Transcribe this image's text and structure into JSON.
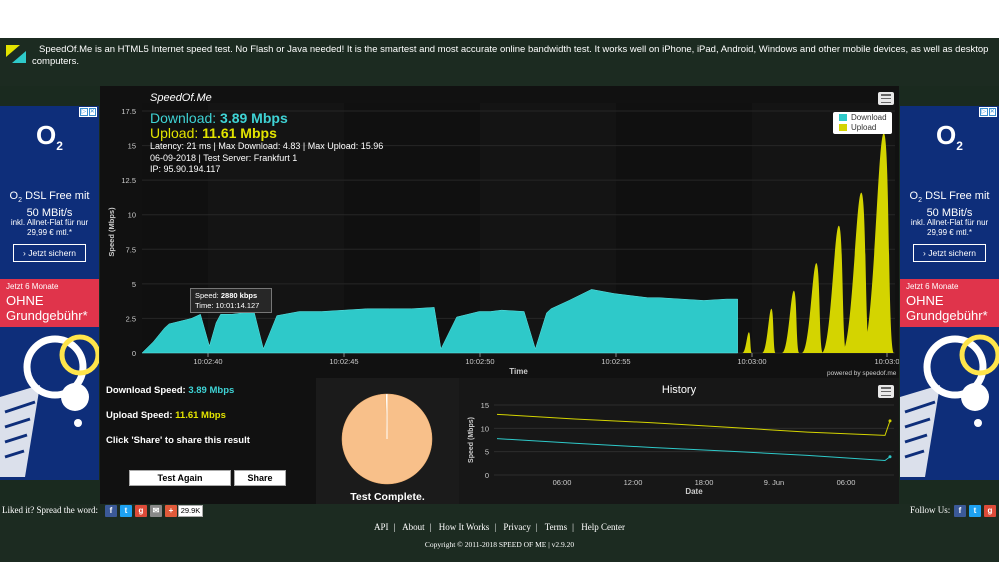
{
  "intro": {
    "text": "SpeedOf.Me is an HTML5 Internet speed test. No Flash or Java needed! It is the smartest and most accurate online bandwidth test. It works well on iPhone, iPad, Android, Windows and other mobile devices, as well as desktop computers."
  },
  "ad": {
    "brand": "O",
    "brand_sub": "2",
    "headline_a": "DSL Free mit",
    "headline_b": "50 MBit/s",
    "sub_a": "inkl. Allnet-Flat für nur",
    "sub_b": "29,99 € mtl.*",
    "button": "Jetzt sichern",
    "promo_small": "Jetzt 6 Monate",
    "promo_big_a": "OHNE",
    "promo_big_b": "Grundgebühr*",
    "close_a": "▷",
    "close_b": "✕"
  },
  "speedtest": {
    "brand": "SpeedOf.Me",
    "download_label": "Download:",
    "download_value": "3.89 Mbps",
    "upload_label": "Upload:",
    "upload_value": "11.61 Mbps",
    "line1": "Latency: 21 ms | Max Download: 4.83 | Max Upload: 15.96",
    "line2": "06-09-2018 | Test Server: Frankfurt 1",
    "line3": "IP: 95.90.194.117",
    "legend_download": "Download",
    "legend_upload": "Upload",
    "tooltip_speed_label": "Speed:",
    "tooltip_speed_value": "2880 kbps",
    "tooltip_time": "Time: 10:01:14.127",
    "powered": "powered by speedof.me",
    "colors": {
      "download": "#2ec9c9",
      "upload": "#d4d400",
      "accent_dl": "#3fd3d5",
      "accent_ul": "#e3e400"
    }
  },
  "results": {
    "download_label": "Download Speed:",
    "download_value": "3.89 Mbps",
    "upload_label": "Upload Speed:",
    "upload_value": "11.61 Mbps",
    "share_hint": "Click 'Share' to share this result",
    "btn_again": "Test Again",
    "btn_share": "Share",
    "complete": "Test Complete."
  },
  "history": {
    "title": "History"
  },
  "footer": {
    "spread": "Liked it? Spread the word:",
    "share_count": "29.9K",
    "follow": "Follow Us:",
    "links": [
      "API",
      "About",
      "How It Works",
      "Privacy",
      "Terms",
      "Help Center"
    ],
    "copyright": "Copyright © 2011-2018 SPEED OF ME | v2.9.20"
  },
  "chart_data": [
    {
      "type": "area",
      "xlabel": "Time",
      "ylabel": "Speed (Mbps)",
      "ylim": [
        0,
        17.5
      ],
      "yticks": [
        0,
        2.5,
        5,
        7.5,
        10,
        12.5,
        15,
        17.5
      ],
      "xticks": [
        "10:02:40",
        "10:02:45",
        "10:02:50",
        "10:02:55",
        "10:03:00",
        "10:03:0"
      ],
      "legend": "top-right",
      "series": [
        {
          "name": "Download",
          "x": [
            0,
            0.5,
            1,
            1.2,
            2.2,
            2.6,
            3,
            3.3,
            3.5,
            4,
            4.5,
            5,
            5.4,
            6,
            7,
            8,
            9,
            10,
            11,
            12,
            13,
            13.3,
            14,
            15,
            15.5,
            16,
            17,
            17.5,
            18,
            18.2,
            19,
            20,
            21,
            22,
            22.5,
            23,
            24,
            25,
            26,
            26.5
          ],
          "y": [
            0,
            0.8,
            1.8,
            2.1,
            2.5,
            2.8,
            0.5,
            2.2,
            2.8,
            2.8,
            2.9,
            2.9,
            0.3,
            2.7,
            3.0,
            3.0,
            3.1,
            3.2,
            3.2,
            3.2,
            3.3,
            0.3,
            2.6,
            3.0,
            3.0,
            3.1,
            3.0,
            0.3,
            2.9,
            3.2,
            3.8,
            4.6,
            4.3,
            4.1,
            4.0,
            4.0,
            3.9,
            3.8,
            3.9,
            3.9
          ]
        },
        {
          "name": "Upload",
          "x": [
            27,
            28,
            29,
            30,
            31,
            32,
            33
          ],
          "y": [
            1.5,
            3.2,
            4.5,
            6.5,
            9.2,
            11.6,
            15.9
          ]
        }
      ]
    },
    {
      "type": "pie",
      "values": [
        99.5,
        0.5
      ]
    },
    {
      "type": "line",
      "title": "History",
      "xlabel": "Date",
      "ylabel": "Speed (Mbps)",
      "ylim": [
        0,
        15
      ],
      "yticks": [
        0,
        5,
        10,
        15
      ],
      "xticks": [
        "06:00",
        "12:00",
        "18:00",
        "9. Jun",
        "06:00"
      ],
      "series": [
        {
          "name": "Upload",
          "values": [
            13,
            12,
            11.2,
            10.2,
            9.2,
            8.5,
            11.6
          ]
        },
        {
          "name": "Download",
          "values": [
            7.8,
            6.8,
            5.9,
            5.1,
            4.2,
            3.1,
            3.9
          ]
        }
      ]
    }
  ]
}
